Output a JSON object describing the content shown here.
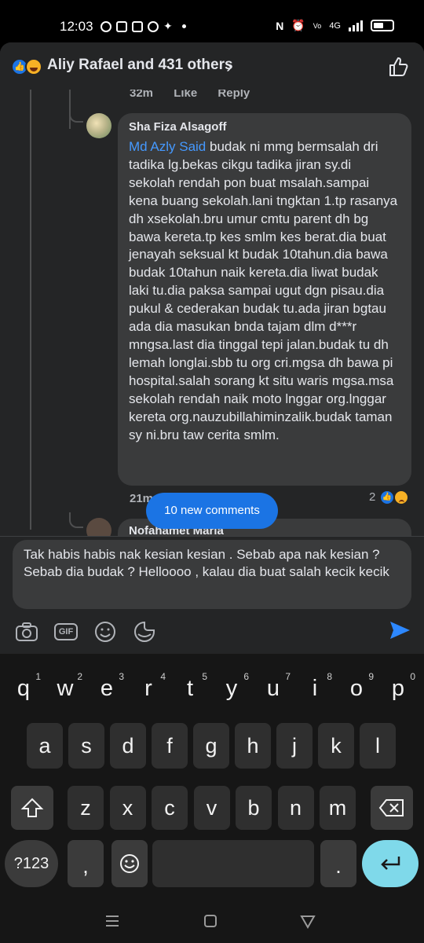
{
  "status_bar": {
    "time": "12:03",
    "right_text": "4G"
  },
  "header": {
    "title": "Aliy Rafael and 431 others",
    "chevron": "›",
    "reaction_icons": [
      "like-icon",
      "haha-icon"
    ],
    "action_icon": "thumbs-up-icon"
  },
  "previous_comment": {
    "time": "32m",
    "like_label": "Like",
    "reply_label": "Reply"
  },
  "comment": {
    "author": "Sha Fiza Alsagoff",
    "mention": "Md Azly Said",
    "text": " budak ni mmg bermsalah dri tadika lg.bekas cikgu tadika jiran sy.di sekolah rendah pon buat msalah.sampai kena buang sekolah.lani tngktan 1.tp rasanya dh xsekolah.bru umur cmtu parent dh bg bawa kereta.tp kes smlm kes berat.dia buat jenayah seksual kt budak 10tahun.dia bawa budak 10tahun naik kereta.dia liwat budak laki tu.dia paksa sampai ugut dgn pisau.dia pukul & cederakan budak tu.ada jiran bgtau ada dia masukan bnda tajam dlm d***r mngsa.last dia tinggal tepi jalan.budak tu dh lemah longlai.sbb tu org cri.mgsa dh bawa pi hospital.salah sorang kt situ waris mgsa.msa sekolah rendah naik moto lnggar org.lnggar kereta org.nauzubillahiminzalik.budak taman sy ni.bru taw cerita smlm.",
    "time": "21m",
    "reaction_count": "2",
    "reaction_icons": [
      "like-icon",
      "sad-icon"
    ]
  },
  "next_comment": {
    "author": "Nofahamet Maria"
  },
  "new_comments_pill": "10 new comments",
  "composer": {
    "text": "Tak habis habis nak kesian kesian . Sebab apa nak kesian ? Sebab dia budak ? Helloooo , kalau dia buat salah kecik kecik",
    "tools": [
      "camera-icon",
      "gif-icon",
      "emoji-icon",
      "sticker-icon"
    ],
    "gif_label": "GIF",
    "send_icon": "send-icon"
  },
  "keyboard": {
    "row1": [
      {
        "key": "q",
        "hint": "1"
      },
      {
        "key": "w",
        "hint": "2"
      },
      {
        "key": "e",
        "hint": "3"
      },
      {
        "key": "r",
        "hint": "4"
      },
      {
        "key": "t",
        "hint": "5"
      },
      {
        "key": "y",
        "hint": "6"
      },
      {
        "key": "u",
        "hint": "7"
      },
      {
        "key": "i",
        "hint": "8"
      },
      {
        "key": "o",
        "hint": "9"
      },
      {
        "key": "p",
        "hint": "0"
      }
    ],
    "row2": [
      "a",
      "s",
      "d",
      "f",
      "g",
      "h",
      "j",
      "k",
      "l"
    ],
    "row3": [
      "z",
      "x",
      "c",
      "v",
      "b",
      "n",
      "m"
    ],
    "symbols_label": "?123",
    "comma_label": ",",
    "period_label": ".",
    "shift_icon": "shift-icon",
    "backspace_icon": "backspace-icon",
    "emoji_icon": "emoji-icon",
    "enter_icon": "enter-icon"
  },
  "nav_bar": {
    "items": [
      "menu-icon",
      "home-icon",
      "back-icon"
    ]
  },
  "colors": {
    "panel": "#242526",
    "bubble": "#3a3b3c",
    "accent": "#1b74e4",
    "mention": "#4599ff",
    "enter_key": "#7fd9ea"
  }
}
